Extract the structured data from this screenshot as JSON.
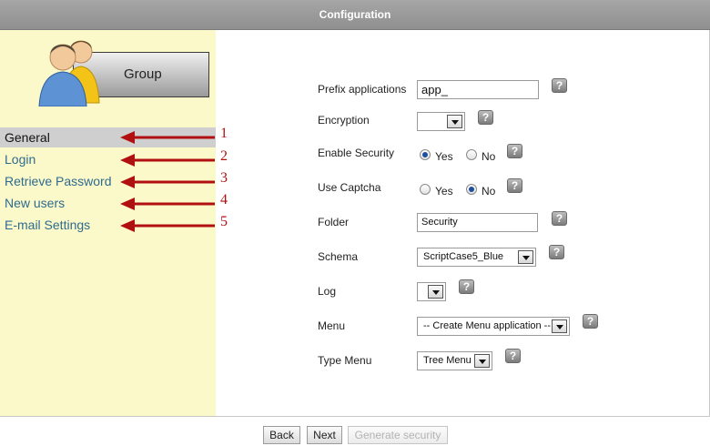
{
  "window": {
    "title": "Configuration"
  },
  "sidebar": {
    "group_label": "Group",
    "items": [
      {
        "label": "General",
        "active": true,
        "marker": "1"
      },
      {
        "label": "Login",
        "active": false,
        "marker": "2"
      },
      {
        "label": "Retrieve Password",
        "active": false,
        "marker": "3"
      },
      {
        "label": "New users",
        "active": false,
        "marker": "4"
      },
      {
        "label": "E-mail Settings",
        "active": false,
        "marker": "5"
      }
    ]
  },
  "form": {
    "prefix": {
      "label": "Prefix applications",
      "value": "app_"
    },
    "encryption": {
      "label": "Encryption",
      "value": ""
    },
    "enable_security": {
      "label": "Enable Security",
      "yes": "Yes",
      "no": "No",
      "selected": "Yes"
    },
    "use_captcha": {
      "label": "Use Captcha",
      "yes": "Yes",
      "no": "No",
      "selected": "No"
    },
    "folder": {
      "label": "Folder",
      "value": "Security"
    },
    "schema": {
      "label": "Schema",
      "value": "ScriptCase5_Blue"
    },
    "log": {
      "label": "Log",
      "value": ""
    },
    "menu": {
      "label": "Menu",
      "value": "-- Create Menu application --"
    },
    "type_menu": {
      "label": "Type Menu",
      "value": "Tree Menu"
    },
    "help_glyph": "?"
  },
  "buttons": {
    "back": "Back",
    "next": "Next",
    "generate": "Generate security"
  },
  "colors": {
    "arrow": "#b11010",
    "sidebar_bg": "#fbf9c9",
    "link": "#2e6b8f"
  }
}
